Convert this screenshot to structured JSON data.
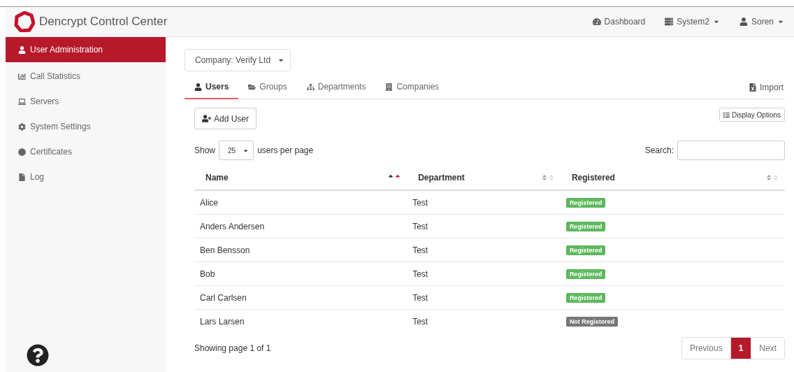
{
  "navbar": {
    "brand": "Dencrypt Control Center",
    "items": [
      {
        "kind": "link",
        "label": "Dashboard"
      },
      {
        "kind": "dropdown",
        "label": "System2"
      },
      {
        "kind": "dropdown",
        "label": "Soren"
      }
    ]
  },
  "sidebar": {
    "items": [
      {
        "label": "User Administration",
        "selected": true
      },
      {
        "label": "Call Statistics",
        "selected": false
      },
      {
        "label": "Servers",
        "selected": false
      },
      {
        "label": "System Settings",
        "selected": false
      },
      {
        "label": "Certificates",
        "selected": false
      },
      {
        "label": "Log",
        "selected": false
      }
    ]
  },
  "company_select": {
    "value": "Company: Verify Ltd"
  },
  "tabs": [
    {
      "label": "Users",
      "selected": true
    },
    {
      "label": "Groups",
      "selected": false
    },
    {
      "label": "Departments",
      "selected": false
    },
    {
      "label": "Companies",
      "selected": false
    }
  ],
  "import_link": "Import",
  "add_user_button": "Add User",
  "display_options_button": "Display Options",
  "page_length": {
    "prefix": "Show",
    "value": "25",
    "suffix": "users per page"
  },
  "search": {
    "label": "Search:"
  },
  "table": {
    "columns": [
      {
        "label": "Name",
        "sorted": true
      },
      {
        "label": "Department",
        "sorted": false
      },
      {
        "label": "Registered",
        "sorted": false
      }
    ],
    "rows": [
      {
        "name": "Alice",
        "department": "Test",
        "status": "Registered",
        "registered": true
      },
      {
        "name": "Anders Andersen",
        "department": "Test",
        "status": "Registered",
        "registered": true
      },
      {
        "name": "Ben Bensson",
        "department": "Test",
        "status": "Registered",
        "registered": true
      },
      {
        "name": "Bob",
        "department": "Test",
        "status": "Registered",
        "registered": true
      },
      {
        "name": "Carl Carlsen",
        "department": "Test",
        "status": "Registered",
        "registered": true
      },
      {
        "name": "Lars Larsen",
        "department": "Test",
        "status": "Not Registered",
        "registered": false
      }
    ]
  },
  "table_info": "Showing page 1 of 1",
  "pagination": [
    {
      "label": "Previous",
      "selected": false
    },
    {
      "label": "1",
      "selected": true
    },
    {
      "label": "Next",
      "selected": false
    }
  ]
}
